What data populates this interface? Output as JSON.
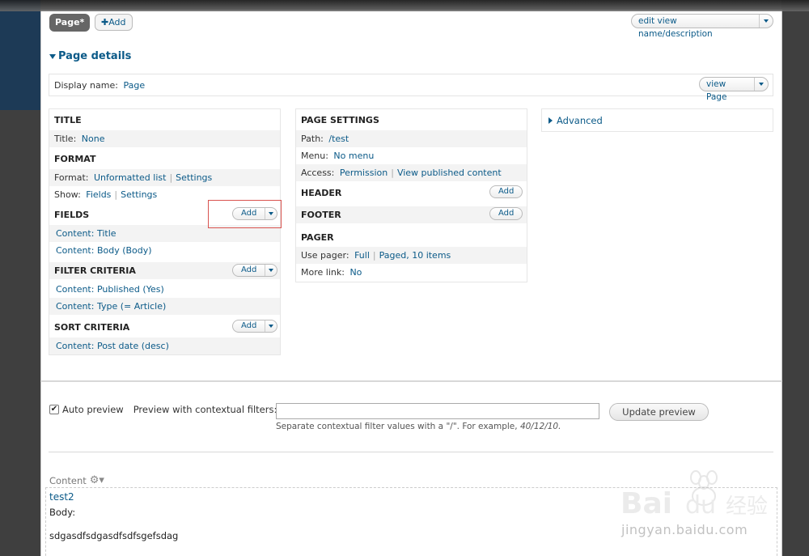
{
  "tabs": {
    "page_label": "Page*",
    "add_label": "Add",
    "add_icon": "plus-icon"
  },
  "header_actions": {
    "edit_view_label": "edit view name/description"
  },
  "page_details": {
    "title": "Page details",
    "display_name_label": "Display name:",
    "display_name_value": "Page",
    "view_page_label": "view Page"
  },
  "column1": {
    "title_heading": "TITLE",
    "title_label": "Title:",
    "title_value": "None",
    "format_heading": "FORMAT",
    "format_label": "Format:",
    "format_value": "Unformatted list",
    "format_settings": "Settings",
    "show_label": "Show:",
    "show_value": "Fields",
    "show_settings": "Settings",
    "fields_heading": "FIELDS",
    "fields": [
      "Content: Title",
      "Content: Body (Body)"
    ],
    "filter_heading": "FILTER CRITERIA",
    "filters": [
      "Content: Published (Yes)",
      "Content: Type (= Article)"
    ],
    "sort_heading": "SORT CRITERIA",
    "sorts": [
      "Content: Post date (desc)"
    ],
    "add_label": "Add"
  },
  "column2": {
    "page_settings_heading": "PAGE SETTINGS",
    "path_label": "Path:",
    "path_value": "/test",
    "menu_label": "Menu:",
    "menu_value": "No menu",
    "access_label": "Access:",
    "access_value": "Permission",
    "access_extra": "View published content",
    "header_heading": "HEADER",
    "footer_heading": "FOOTER",
    "pager_heading": "PAGER",
    "use_pager_label": "Use pager:",
    "use_pager_value": "Full",
    "use_pager_extra": "Paged, 10 items",
    "more_link_label": "More link:",
    "more_link_value": "No",
    "add_label": "Add"
  },
  "column3": {
    "advanced_label": "Advanced"
  },
  "preview": {
    "auto_preview_label": "Auto preview",
    "auto_preview_checked": true,
    "contextual_label": "Preview with contextual filters:",
    "contextual_value": "",
    "update_label": "Update preview",
    "help_text": "Separate contextual filter values with a \"/\". For example,",
    "help_example": "40/12/10."
  },
  "content": {
    "label": "Content",
    "gear_icon": "gear-icon",
    "node_title": "test2",
    "body_label": "Body:",
    "body_text": "sdgasdfsdgasdfsdfsgefsdag"
  },
  "watermark": {
    "brand": "Bai du 经验",
    "url": "jingyan.baidu.com"
  }
}
